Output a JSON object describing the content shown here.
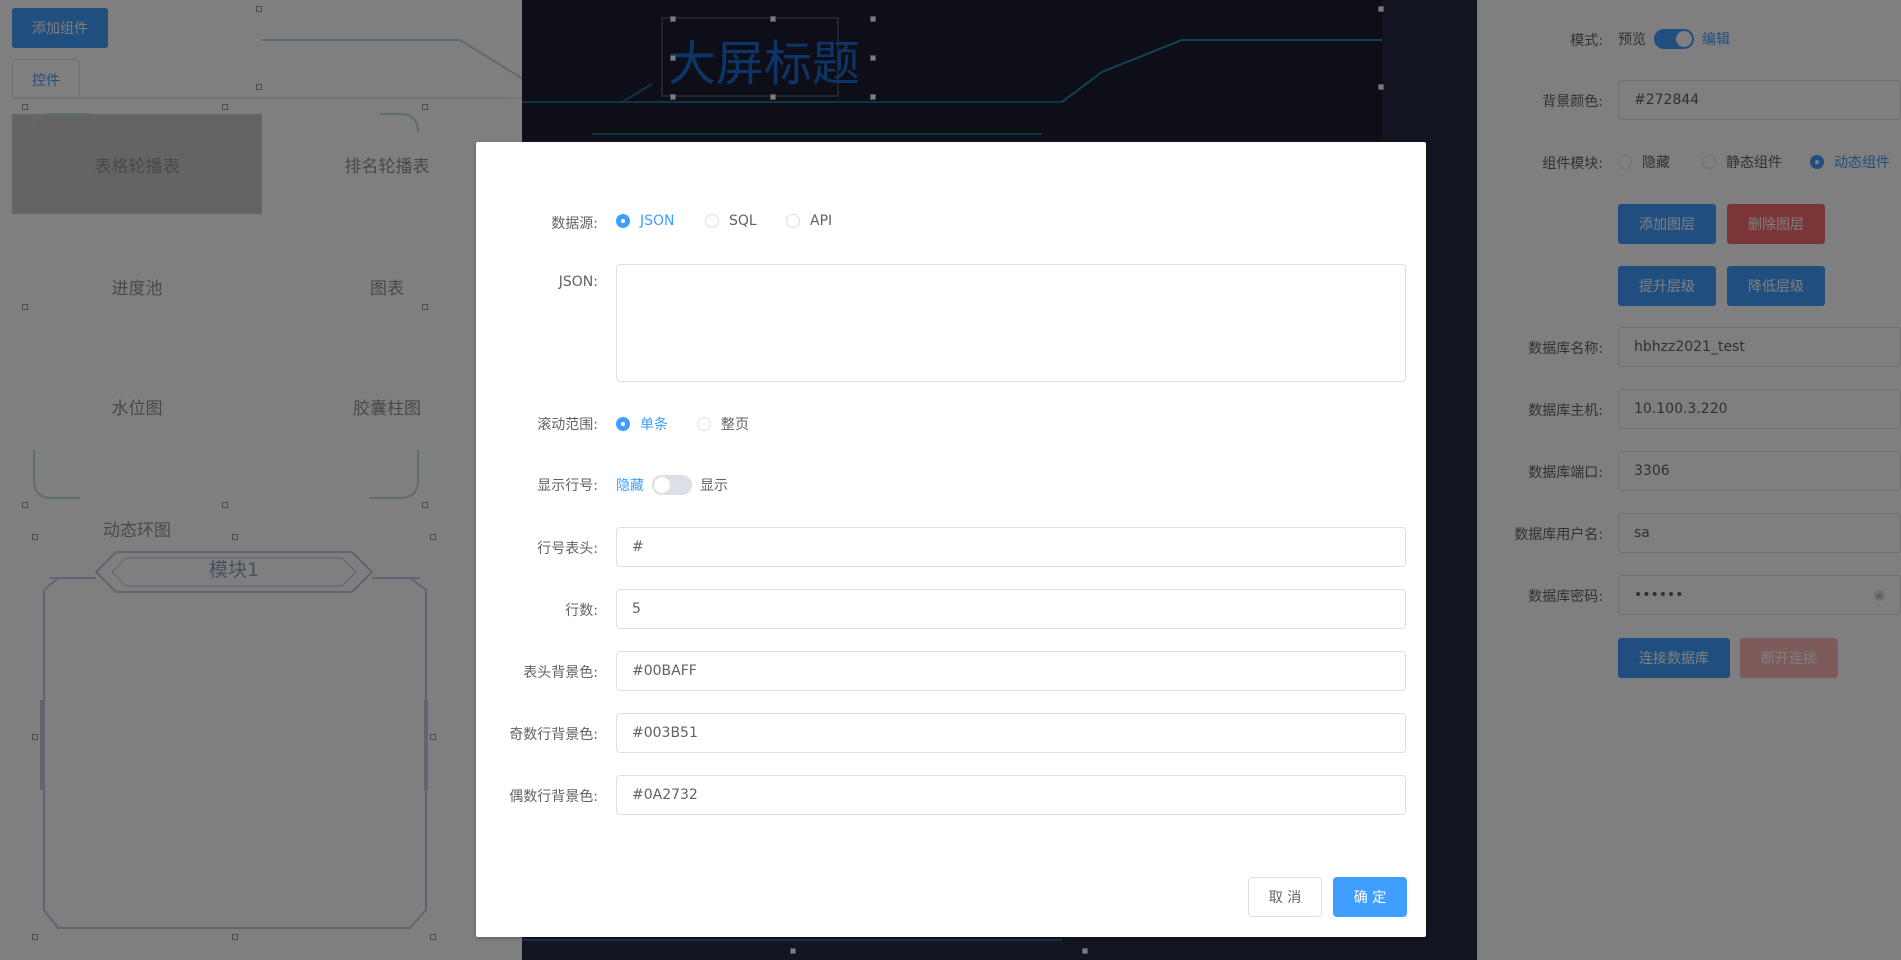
{
  "left": {
    "add_component": "添加组件",
    "tab_controls": "控件",
    "components": [
      "表格轮播表",
      "排名轮播表",
      "进度池",
      "图表",
      "水位图",
      "胶囊柱图",
      "动态环图"
    ],
    "module_title": "模块1"
  },
  "canvas": {
    "screen_title": "大屏标题",
    "background": "#272844"
  },
  "right": {
    "mode_label": "模式:",
    "mode_preview": "预览",
    "mode_edit": "编辑",
    "bg_color_label": "背景颜色:",
    "bg_color_value": "#272844",
    "component_module_label": "组件模块:",
    "module_options": [
      "隐藏",
      "静态组件",
      "动态组件"
    ],
    "module_selected": "动态组件",
    "add_layer": "添加图层",
    "delete_layer": "删除图层",
    "raise_layer": "提升层级",
    "lower_layer": "降低层级",
    "db_name_label": "数据库名称:",
    "db_name_value": "hbhzz2021_test",
    "db_host_label": "数据库主机:",
    "db_host_value": "10.100.3.220",
    "db_port_label": "数据库端口:",
    "db_port_value": "3306",
    "db_user_label": "数据库用户名:",
    "db_user_value": "sa",
    "db_pass_label": "数据库密码:",
    "db_pass_value": "••••••",
    "connect_db": "连接数据库",
    "disconnect": "断开连接"
  },
  "dialog": {
    "datasource_label": "数据源:",
    "datasource_options": [
      "JSON",
      "SQL",
      "API"
    ],
    "datasource_selected": "JSON",
    "json_label": "JSON:",
    "json_value": "",
    "scroll_range_label": "滚动范围:",
    "scroll_options": [
      "单条",
      "整页"
    ],
    "scroll_selected": "单条",
    "show_rownum_label": "显示行号:",
    "rownum_hide": "隐藏",
    "rownum_show": "显示",
    "rownum_header_label": "行号表头:",
    "rownum_header_value": "#",
    "rows_label": "行数:",
    "rows_value": "5",
    "header_bg_label": "表头背景色:",
    "header_bg_value": "#00BAFF",
    "odd_bg_label": "奇数行背景色:",
    "odd_bg_value": "#003B51",
    "even_bg_label": "偶数行背景色:",
    "even_bg_value": "#0A2732",
    "cancel": "取 消",
    "confirm": "确 定"
  },
  "colors": {
    "primary": "#409eff",
    "danger": "#f56c6c",
    "overlay": "rgba(0,0,0,0.5)"
  }
}
